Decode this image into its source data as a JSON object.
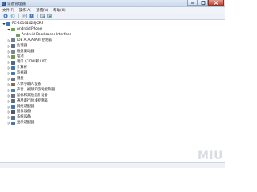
{
  "window": {
    "title": "设备管理器"
  },
  "menu": [
    {
      "label": "文件(F)"
    },
    {
      "label": "操作(A)"
    },
    {
      "label": "查看(V)"
    },
    {
      "label": "帮助(H)"
    }
  ],
  "toolbar": [
    {
      "icon": "back-arrow-icon"
    },
    {
      "icon": "forward-arrow-icon"
    },
    {
      "icon": "properties-icon"
    },
    {
      "icon": "help-icon"
    },
    {
      "icon": "scan-hardware-icon"
    },
    {
      "icon": "update-driver-icon"
    }
  ],
  "tree": {
    "root": "PC-20161028JORF",
    "nodes": [
      {
        "label": "Android Phone",
        "level": 1,
        "expanded": true,
        "icon": "phone-icon",
        "color": "#6aa84f"
      },
      {
        "label": "Android Bootloader Interface",
        "level": 2,
        "expanded": null,
        "icon": "phone-icon",
        "color": "#6aa84f"
      },
      {
        "label": "IDE ATA/ATAPI 控制器",
        "level": 1,
        "expanded": false,
        "icon": "controller-icon",
        "color": "#6b7f99"
      },
      {
        "label": "处理器",
        "level": 1,
        "expanded": false,
        "icon": "processor-icon",
        "color": "#5b6f8a"
      },
      {
        "label": "磁盘驱动器",
        "level": 1,
        "expanded": false,
        "icon": "disk-icon",
        "color": "#7d8794"
      },
      {
        "label": "电池",
        "level": 1,
        "expanded": false,
        "icon": "battery-icon",
        "color": "#6c9a4a"
      },
      {
        "label": "端口 (COM 和 LPT)",
        "level": 1,
        "expanded": false,
        "icon": "port-icon",
        "color": "#4a6b8c"
      },
      {
        "label": "计算机",
        "level": 1,
        "expanded": false,
        "icon": "computer-icon",
        "color": "#3f78b5"
      },
      {
        "label": "监视器",
        "level": 1,
        "expanded": false,
        "icon": "monitor-icon",
        "color": "#3f78b5"
      },
      {
        "label": "键盘",
        "level": 1,
        "expanded": false,
        "icon": "keyboard-icon",
        "color": "#6b7380"
      },
      {
        "label": "人体学输入设备",
        "level": 1,
        "expanded": false,
        "icon": "hid-icon",
        "color": "#8a6b3f"
      },
      {
        "label": "声音、视频和游戏控制器",
        "level": 1,
        "expanded": false,
        "icon": "sound-icon",
        "color": "#4d7fa8"
      },
      {
        "label": "鼠标和其他指针设备",
        "level": 1,
        "expanded": false,
        "icon": "mouse-icon",
        "color": "#6b7380"
      },
      {
        "label": "通用串行总线控制器",
        "level": 1,
        "expanded": false,
        "icon": "usb-icon",
        "color": "#5a6d84"
      },
      {
        "label": "网络适配器",
        "level": 1,
        "expanded": false,
        "icon": "network-icon",
        "color": "#3f78b5"
      },
      {
        "label": "图像设备",
        "level": 1,
        "expanded": false,
        "icon": "camera-icon",
        "color": "#4d5a6b"
      },
      {
        "label": "系统设备",
        "level": 1,
        "expanded": false,
        "icon": "system-icon",
        "color": "#5b6f8a"
      },
      {
        "label": "显示适配器",
        "level": 1,
        "expanded": false,
        "icon": "display-adapter-icon",
        "color": "#3f78b5"
      }
    ]
  },
  "watermark": "MIU"
}
